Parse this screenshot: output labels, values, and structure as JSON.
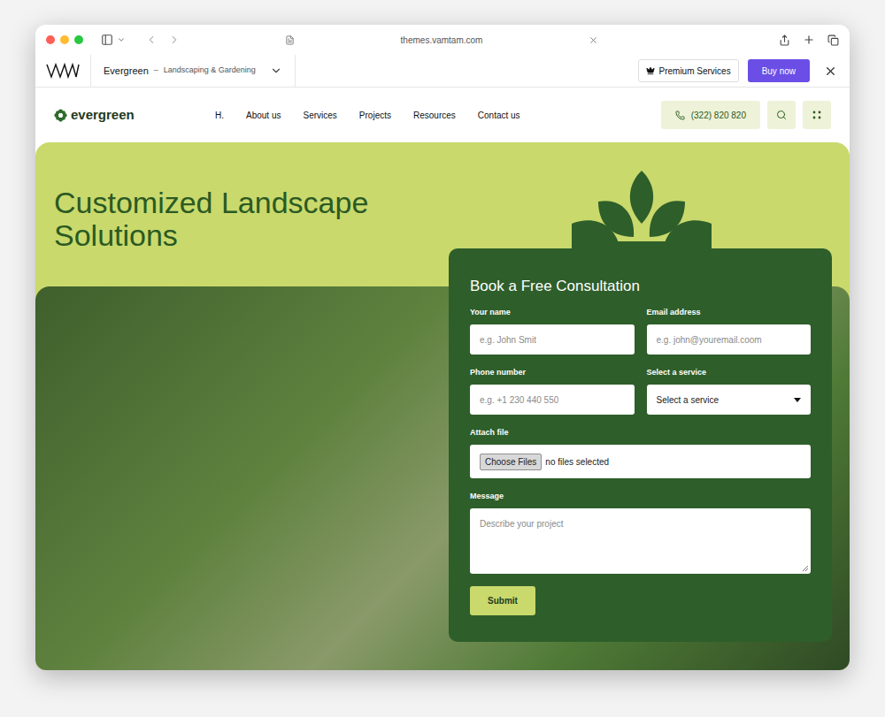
{
  "browser": {
    "url": "themes.vamtam.com"
  },
  "theme_bar": {
    "title": "Evergreen",
    "separator": "–",
    "subtitle": "Landscaping & Gardening",
    "premium": "Premium Services",
    "buy": "Buy now"
  },
  "site_nav": {
    "logo": "evergreen",
    "items": [
      "H.",
      "About us",
      "Services",
      "Projects",
      "Resources",
      "Contact us"
    ],
    "phone": "(322) 820 820"
  },
  "hero": {
    "title": "Customized Landscape Solutions"
  },
  "form": {
    "title": "Book a Free Consultation",
    "fields": [
      {
        "kind": "input",
        "label": "Your name",
        "placeholder": "e.g. John Smit"
      },
      {
        "kind": "input",
        "label": "Email address",
        "placeholder": "e.g. john@youremail.coom"
      },
      {
        "kind": "input",
        "label": "Phone number",
        "placeholder": "e.g. +1 230 440 550"
      },
      {
        "kind": "select",
        "label": "Select a service",
        "value": "Select a service"
      },
      {
        "kind": "file",
        "label": "Attach file",
        "button": "Choose Files",
        "status": "no files selected"
      },
      {
        "kind": "textarea",
        "label": "Message",
        "placeholder": "Describe your project"
      }
    ],
    "submit": "Submit"
  }
}
